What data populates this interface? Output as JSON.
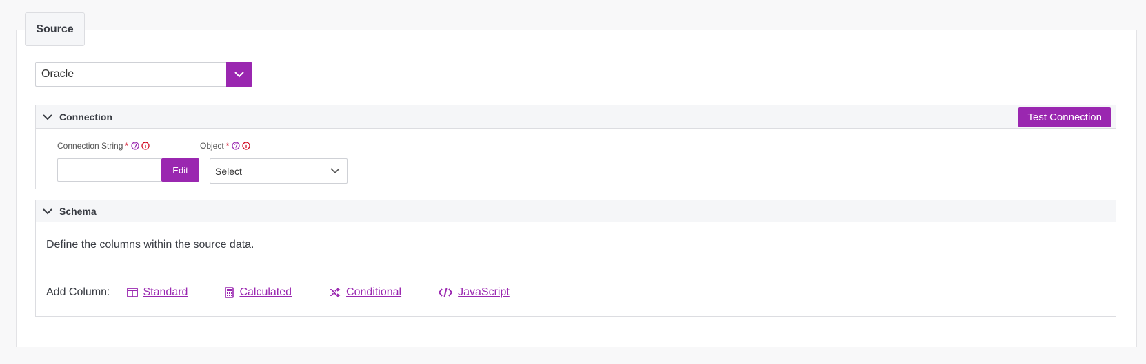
{
  "legend": "Source",
  "source_select": {
    "value": "Oracle"
  },
  "connection": {
    "title": "Connection",
    "test_button": "Test Connection",
    "conn_string": {
      "label": "Connection String",
      "required_mark": "*",
      "value": "",
      "edit_label": "Edit"
    },
    "object": {
      "label": "Object",
      "required_mark": "*",
      "value": "Select"
    }
  },
  "schema": {
    "title": "Schema",
    "description": "Define the columns within the source data.",
    "add_column_label": "Add Column:",
    "links": [
      {
        "label": "Standard",
        "icon": "table-columns-icon"
      },
      {
        "label": "Calculated",
        "icon": "calculator-icon"
      },
      {
        "label": "Conditional",
        "icon": "shuffle-icon"
      },
      {
        "label": "JavaScript",
        "icon": "code-icon"
      }
    ]
  },
  "colors": {
    "accent": "#9a27b0",
    "required": "#d0021b"
  }
}
